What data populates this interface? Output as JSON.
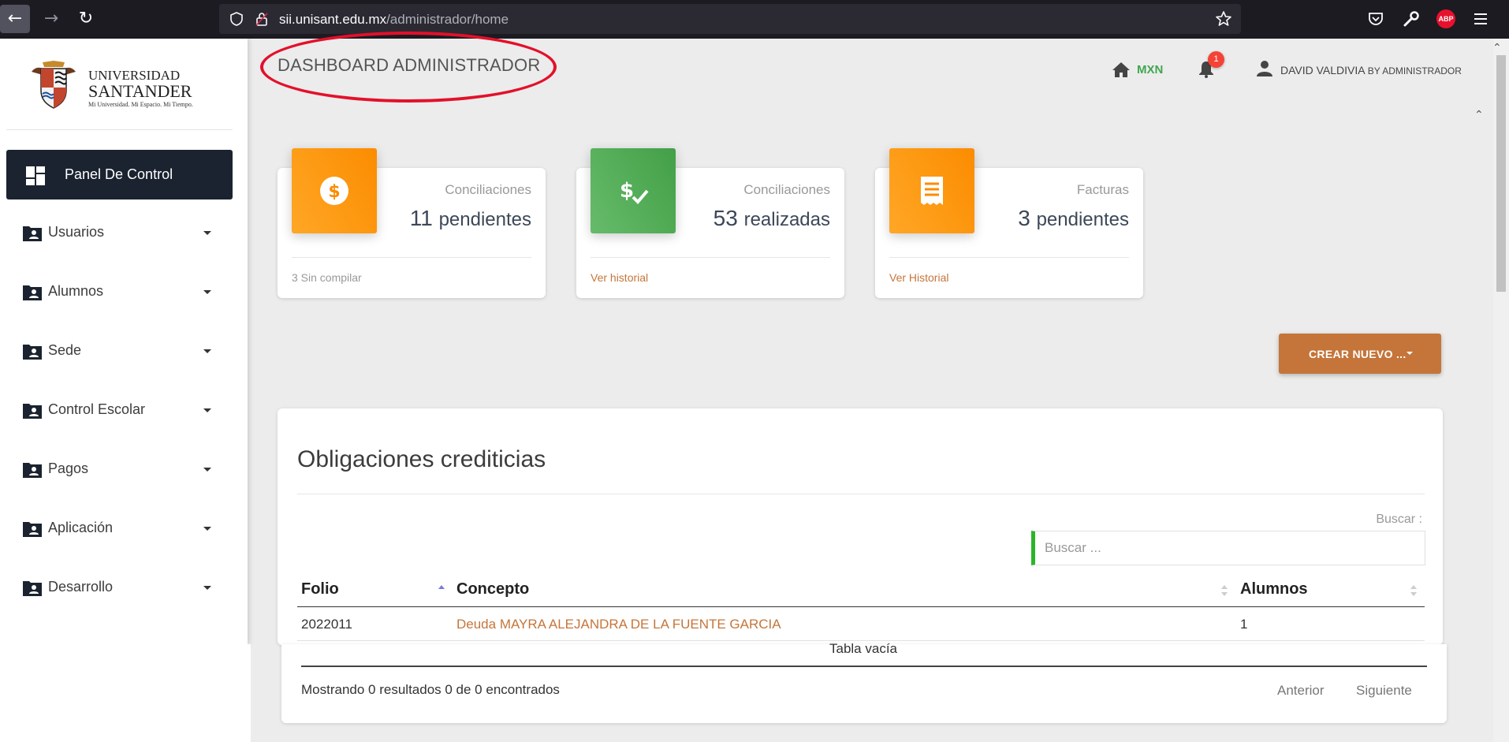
{
  "browser": {
    "url_host": "sii.unisant.edu.mx",
    "url_path": "/administrador/home",
    "abp_label": "ABP"
  },
  "logo": {
    "line1": "UNIVERSIDAD",
    "line2": "SANTANDER",
    "tagline": "Mi Universidad. Mi Espacio. Mi Tiempo."
  },
  "sidebar": {
    "active": "Panel De Control",
    "items": [
      {
        "label": "Usuarios"
      },
      {
        "label": "Alumnos"
      },
      {
        "label": "Sede"
      },
      {
        "label": "Control Escolar"
      },
      {
        "label": "Pagos"
      },
      {
        "label": "Aplicación"
      },
      {
        "label": "Desarrollo"
      }
    ]
  },
  "header": {
    "title": "DASHBOARD ADMINISTRADOR",
    "currency": "MXN",
    "notifications": "1",
    "user_name": "DAVID VALDIVIA",
    "user_role": "BY ADMINISTRADOR",
    "highlight_color": "#e3102a"
  },
  "stats": [
    {
      "category": "Conciliaciones",
      "value": "11",
      "unit": "pendientes",
      "footer": "3 Sin compilar",
      "icon": "dollar-circle-icon",
      "color": "#fb8c00"
    },
    {
      "category": "Conciliaciones",
      "value": "53",
      "unit": "realizadas",
      "footer": "Ver historial",
      "icon": "dollar-check-icon",
      "color": "#43a047"
    },
    {
      "category": "Facturas",
      "value": "3",
      "unit": "pendientes",
      "footer": "Ver Historial",
      "icon": "receipt-icon",
      "color": "#fb8c00"
    }
  ],
  "create_button": "CREAR NUEVO ...",
  "table": {
    "title": "Obligaciones crediticias",
    "search_label": "Buscar :",
    "search_placeholder": "Buscar ...",
    "columns": [
      "Folio",
      "Concepto",
      "Alumnos"
    ],
    "rows": [
      {
        "folio": "2022011",
        "concepto": "Deuda MAYRA ALEJANDRA DE LA FUENTE GARCIA",
        "alumnos": "1"
      }
    ],
    "empty_text": "Tabla vacía",
    "info": "Mostrando 0 resultados 0 de 0 encontrados",
    "prev": "Anterior",
    "next": "Siguiente"
  },
  "colors": {
    "accent": "#c5753a",
    "sidebar_active": "#1b2330",
    "search_accent": "#2bb52b"
  }
}
